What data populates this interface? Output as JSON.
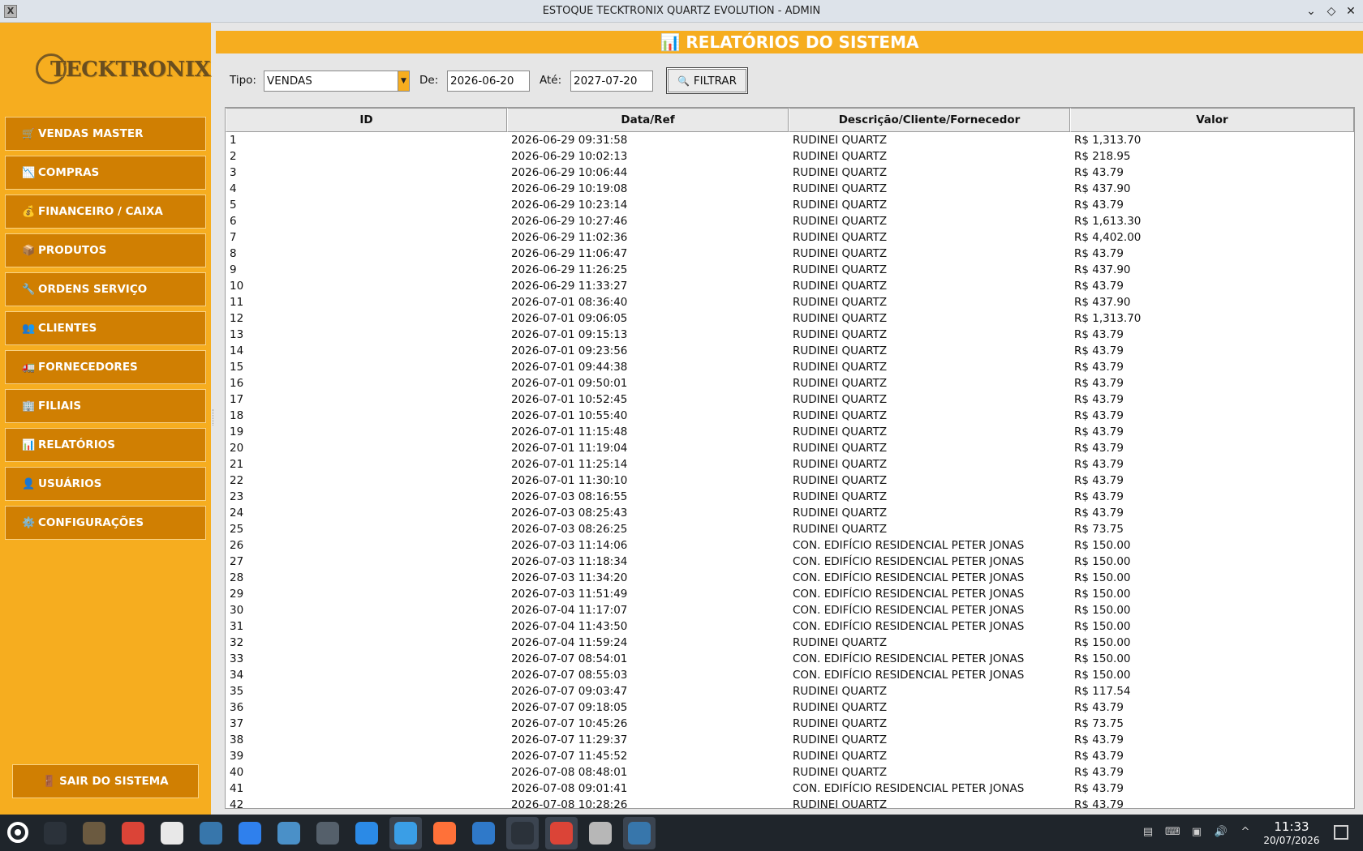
{
  "window": {
    "title": "ESTOQUE TECKTRONIX QUARTZ EVOLUTION - ADMIN",
    "icon_name": "app-x-icon"
  },
  "sidebar": {
    "logo_text": "TECKTRONIX",
    "items": [
      {
        "icon": "🛒",
        "icon_name": "cart-icon",
        "label": "VENDAS MASTER"
      },
      {
        "icon": "📉",
        "icon_name": "chart-down-icon",
        "label": "COMPRAS"
      },
      {
        "icon": "💰",
        "icon_name": "money-bag-icon",
        "label": "FINANCEIRO / CAIXA"
      },
      {
        "icon": "📦",
        "icon_name": "package-icon",
        "label": "PRODUTOS"
      },
      {
        "icon": "🔧",
        "icon_name": "wrench-icon",
        "label": "ORDENS SERVIÇO"
      },
      {
        "icon": "👥",
        "icon_name": "users-icon",
        "label": "CLIENTES"
      },
      {
        "icon": "🚛",
        "icon_name": "truck-icon",
        "label": "FORNECEDORES"
      },
      {
        "icon": "🏢",
        "icon_name": "building-icon",
        "label": "FILIAIS"
      },
      {
        "icon": "📊",
        "icon_name": "bar-chart-icon",
        "label": "RELATÓRIOS"
      },
      {
        "icon": "👤",
        "icon_name": "user-icon",
        "label": "USUÁRIOS"
      },
      {
        "icon": "⚙️",
        "icon_name": "gear-icon",
        "label": "CONFIGURAÇÕES"
      }
    ],
    "exit": {
      "icon": "🚪",
      "icon_name": "door-icon",
      "label": "SAIR DO SISTEMA"
    }
  },
  "main": {
    "header": "📊 RELATÓRIOS DO SISTEMA",
    "filters": {
      "type_label": "Tipo:",
      "type_value": "VENDAS",
      "from_label": "De:",
      "from_value": "2026-06-20",
      "to_label": "Até:",
      "to_value": "2027-07-20",
      "button_icon": "🔍",
      "button_label": "FILTRAR"
    },
    "table": {
      "columns": [
        "ID",
        "Data/Ref",
        "Descrição/Cliente/Fornecedor",
        "Valor"
      ],
      "rows": [
        [
          "1",
          "2026-06-29 09:31:58",
          "RUDINEI QUARTZ",
          "R$ 1,313.70"
        ],
        [
          "2",
          "2026-06-29 10:02:13",
          "RUDINEI QUARTZ",
          "R$ 218.95"
        ],
        [
          "3",
          "2026-06-29 10:06:44",
          "RUDINEI QUARTZ",
          "R$ 43.79"
        ],
        [
          "4",
          "2026-06-29 10:19:08",
          "RUDINEI QUARTZ",
          "R$ 437.90"
        ],
        [
          "5",
          "2026-06-29 10:23:14",
          "RUDINEI QUARTZ",
          "R$ 43.79"
        ],
        [
          "6",
          "2026-06-29 10:27:46",
          "RUDINEI QUARTZ",
          "R$ 1,613.30"
        ],
        [
          "7",
          "2026-06-29 11:02:36",
          "RUDINEI QUARTZ",
          "R$ 4,402.00"
        ],
        [
          "8",
          "2026-06-29 11:06:47",
          "RUDINEI QUARTZ",
          "R$ 43.79"
        ],
        [
          "9",
          "2026-06-29 11:26:25",
          "RUDINEI QUARTZ",
          "R$ 437.90"
        ],
        [
          "10",
          "2026-06-29 11:33:27",
          "RUDINEI QUARTZ",
          "R$ 43.79"
        ],
        [
          "11",
          "2026-07-01 08:36:40",
          "RUDINEI QUARTZ",
          "R$ 437.90"
        ],
        [
          "12",
          "2026-07-01 09:06:05",
          "RUDINEI QUARTZ",
          "R$ 1,313.70"
        ],
        [
          "13",
          "2026-07-01 09:15:13",
          "RUDINEI QUARTZ",
          "R$ 43.79"
        ],
        [
          "14",
          "2026-07-01 09:23:56",
          "RUDINEI QUARTZ",
          "R$ 43.79"
        ],
        [
          "15",
          "2026-07-01 09:44:38",
          "RUDINEI QUARTZ",
          "R$ 43.79"
        ],
        [
          "16",
          "2026-07-01 09:50:01",
          "RUDINEI QUARTZ",
          "R$ 43.79"
        ],
        [
          "17",
          "2026-07-01 10:52:45",
          "RUDINEI QUARTZ",
          "R$ 43.79"
        ],
        [
          "18",
          "2026-07-01 10:55:40",
          "RUDINEI QUARTZ",
          "R$ 43.79"
        ],
        [
          "19",
          "2026-07-01 11:15:48",
          "RUDINEI QUARTZ",
          "R$ 43.79"
        ],
        [
          "20",
          "2026-07-01 11:19:04",
          "RUDINEI QUARTZ",
          "R$ 43.79"
        ],
        [
          "21",
          "2026-07-01 11:25:14",
          "RUDINEI QUARTZ",
          "R$ 43.79"
        ],
        [
          "22",
          "2026-07-01 11:30:10",
          "RUDINEI QUARTZ",
          "R$ 43.79"
        ],
        [
          "23",
          "2026-07-03 08:16:55",
          "RUDINEI QUARTZ",
          "R$ 43.79"
        ],
        [
          "24",
          "2026-07-03 08:25:43",
          "RUDINEI QUARTZ",
          "R$ 43.79"
        ],
        [
          "25",
          "2026-07-03 08:26:25",
          "RUDINEI QUARTZ",
          "R$ 73.75"
        ],
        [
          "26",
          "2026-07-03 11:14:06",
          "CON. EDIFÍCIO RESIDENCIAL PETER JONAS",
          "R$ 150.00"
        ],
        [
          "27",
          "2026-07-03 11:18:34",
          "CON. EDIFÍCIO RESIDENCIAL PETER JONAS",
          "R$ 150.00"
        ],
        [
          "28",
          "2026-07-03 11:34:20",
          "CON. EDIFÍCIO RESIDENCIAL PETER JONAS",
          "R$ 150.00"
        ],
        [
          "29",
          "2026-07-03 11:51:49",
          "CON. EDIFÍCIO RESIDENCIAL PETER JONAS",
          "R$ 150.00"
        ],
        [
          "30",
          "2026-07-04 11:17:07",
          "CON. EDIFÍCIO RESIDENCIAL PETER JONAS",
          "R$ 150.00"
        ],
        [
          "31",
          "2026-07-04 11:43:50",
          "CON. EDIFÍCIO RESIDENCIAL PETER JONAS",
          "R$ 150.00"
        ],
        [
          "32",
          "2026-07-04 11:59:24",
          "RUDINEI QUARTZ",
          "R$ 150.00"
        ],
        [
          "33",
          "2026-07-07 08:54:01",
          "CON. EDIFÍCIO RESIDENCIAL PETER JONAS",
          "R$ 150.00"
        ],
        [
          "34",
          "2026-07-07 08:55:03",
          "CON. EDIFÍCIO RESIDENCIAL PETER JONAS",
          "R$ 150.00"
        ],
        [
          "35",
          "2026-07-07 09:03:47",
          "RUDINEI QUARTZ",
          "R$ 117.54"
        ],
        [
          "36",
          "2026-07-07 09:18:05",
          "RUDINEI QUARTZ",
          "R$ 43.79"
        ],
        [
          "37",
          "2026-07-07 10:45:26",
          "RUDINEI QUARTZ",
          "R$ 73.75"
        ],
        [
          "38",
          "2026-07-07 11:29:37",
          "RUDINEI QUARTZ",
          "R$ 43.79"
        ],
        [
          "39",
          "2026-07-07 11:45:52",
          "RUDINEI QUARTZ",
          "R$ 43.79"
        ],
        [
          "40",
          "2026-07-08 08:48:01",
          "RUDINEI QUARTZ",
          "R$ 43.79"
        ],
        [
          "41",
          "2026-07-08 09:01:41",
          "CON. EDIFÍCIO RESIDENCIAL PETER JONAS",
          "R$ 43.79"
        ],
        [
          "42",
          "2026-07-08 10:28:26",
          "RUDINEI QUARTZ",
          "R$ 43.79"
        ]
      ]
    }
  },
  "taskbar": {
    "apps": [
      {
        "name": "terminal-icon",
        "color": "#2b323a",
        "active": false
      },
      {
        "name": "gimp-icon",
        "color": "#6b5a40",
        "active": false
      },
      {
        "name": "chrome-icon",
        "color": "#db4437",
        "active": false
      },
      {
        "name": "text-editor-icon",
        "color": "#e8e8e8",
        "active": false
      },
      {
        "name": "python-icon",
        "color": "#3776ab",
        "active": false
      },
      {
        "name": "document-icon",
        "color": "#2f80ed",
        "active": false
      },
      {
        "name": "fish-icon",
        "color": "#4a90c8",
        "active": false
      },
      {
        "name": "settings-sliders-icon",
        "color": "#55606b",
        "active": false
      },
      {
        "name": "store-bag-icon",
        "color": "#2b8ae6",
        "active": false
      },
      {
        "name": "file-manager-icon",
        "color": "#3a9ee6",
        "active": true
      },
      {
        "name": "firefox-icon",
        "color": "#ff7139",
        "active": false
      },
      {
        "name": "thunderbird-icon",
        "color": "#2f79c9",
        "active": false
      },
      {
        "name": "terminal-icon-2",
        "color": "#2b323a",
        "active": true
      },
      {
        "name": "chrome-icon-2",
        "color": "#db4437",
        "active": true
      },
      {
        "name": "database-icon",
        "color": "#b7b7b7",
        "active": false
      },
      {
        "name": "python-app-icon",
        "color": "#3776ab",
        "active": true
      }
    ],
    "tray": [
      {
        "name": "clipboard-icon",
        "glyph": "▤"
      },
      {
        "name": "keyboard-icon",
        "glyph": "⌨"
      },
      {
        "name": "network-icon",
        "glyph": "▣"
      },
      {
        "name": "volume-icon",
        "glyph": "🔊"
      },
      {
        "name": "tray-expand-icon",
        "glyph": "^"
      }
    ],
    "time": "11:33",
    "date": "20/07/2026"
  }
}
